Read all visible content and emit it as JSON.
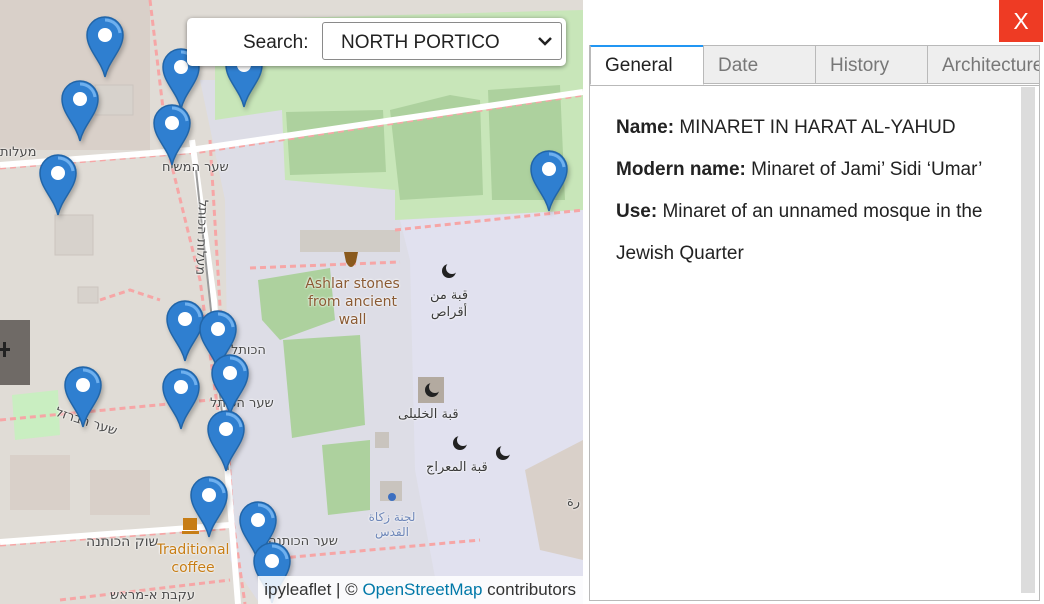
{
  "map": {
    "search": {
      "label": "Search:",
      "selected": "NORTH PORTICO"
    },
    "attribution": {
      "prefix": "ipyleaflet | © ",
      "link": "OpenStreetMap",
      "suffix": " contributors"
    },
    "labels": {
      "ashlar": "Ashlar stones from ancient wall",
      "traditional_coffee": "Traditional coffee",
      "qubba_min_aqras": "قبة من أقراص",
      "qubba_al_khalili": "قبة الخليلى",
      "qubba_al_miraj": "قبة المعراج",
      "lajnat_zakat": "لجنة زكاة القدس",
      "shaar_hamashiach": "שער המשיח",
      "maalot": "מעלות",
      "maalot_hakotel": "מעלות הכותל",
      "hakotel": "הכותל",
      "shaar_hakotel": "שער הכותל",
      "shaar_habarzel": "שער הברזל",
      "shuk_hakotna": "שוק הכותנה",
      "shaar_hakotna": "שער הכותנה",
      "akavat_a_marash": "עקבת א-מראש",
      "ra": "رة"
    },
    "markers_count": 18
  },
  "panel": {
    "close_label": "X",
    "tabs": [
      {
        "label": "General",
        "active": true
      },
      {
        "label": "Date",
        "active": false
      },
      {
        "label": "History",
        "active": false
      },
      {
        "label": "Architecture",
        "active": false
      }
    ],
    "fields": [
      {
        "label": "Name:",
        "value": "MINARET IN HARAT AL-YAHUD"
      },
      {
        "label": "Modern name:",
        "value": "Minaret of Jami’ Sidi ‘Umar’"
      },
      {
        "label": "Use:",
        "value": "Minaret of an unnamed mosque in the Jewish Quarter"
      }
    ]
  },
  "colors": {
    "marker": "#2f7fd0",
    "close_button": "#ee3b24",
    "active_tab_accent": "#2196f3",
    "link": "#0078a8"
  }
}
